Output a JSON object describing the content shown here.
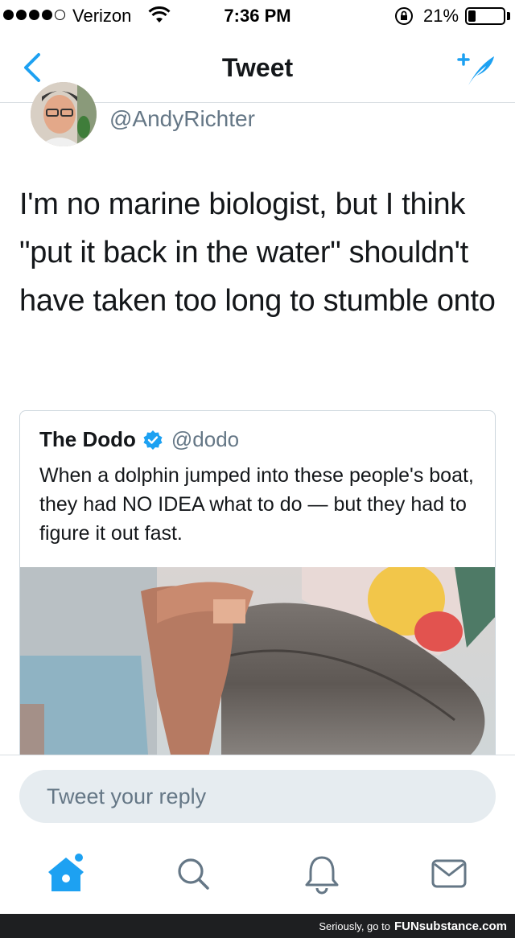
{
  "status_bar": {
    "carrier": "Verizon",
    "time": "7:36 PM",
    "battery_percent": "21%",
    "battery_level": 0.21,
    "signal_bars_filled": 4,
    "signal_bars_total": 5
  },
  "nav": {
    "title": "Tweet",
    "back_icon": "chevron-left-icon",
    "compose_icon": "compose-tweet-icon",
    "accent_color": "#1da1f2"
  },
  "tweet": {
    "handle": "@AndyRichter",
    "text": "I'm no marine biologist, but I think \"put it back in the water\" shouldn't have taken too long to stumble onto"
  },
  "quoted_tweet": {
    "name": "The Dodo",
    "handle": "@dodo",
    "verified": true,
    "text": "When a dolphin jumped into these people's boat, they had NO IDEA what to do — but they had to figure it out fast."
  },
  "reply": {
    "placeholder": "Tweet your reply"
  },
  "tab_bar": {
    "tabs": [
      {
        "icon": "home-icon",
        "active": true
      },
      {
        "icon": "search-icon",
        "active": false
      },
      {
        "icon": "notifications-bell-icon",
        "active": false
      },
      {
        "icon": "messages-envelope-icon",
        "active": false
      }
    ]
  },
  "watermark": {
    "prefix": "Seriously, go to",
    "brand": "FUNsubstance.com"
  }
}
